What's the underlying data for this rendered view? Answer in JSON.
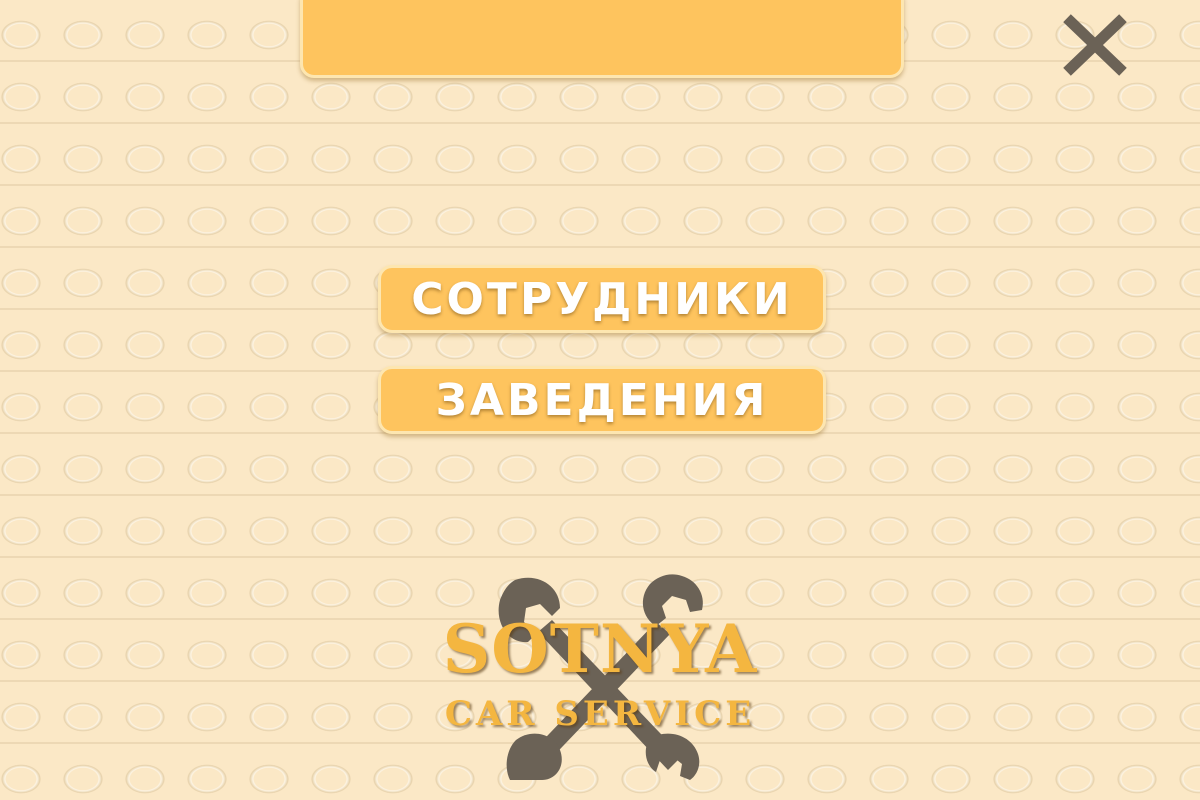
{
  "header": {
    "banner_text": ""
  },
  "toolbar": {
    "close_icon": "close-icon"
  },
  "menu": {
    "items": [
      {
        "label": "СОТРУДНИКИ"
      },
      {
        "label": "ЗАВЕДЕНИЯ"
      }
    ]
  },
  "logo": {
    "title": "SOTNYA",
    "subtitle": "CAR SERVICE",
    "icon": "wrenches-icon"
  },
  "colors": {
    "background": "#fbe8c6",
    "accent": "#fec45e",
    "icon_dark": "#6b6256",
    "logo_text": "#f4b640"
  }
}
